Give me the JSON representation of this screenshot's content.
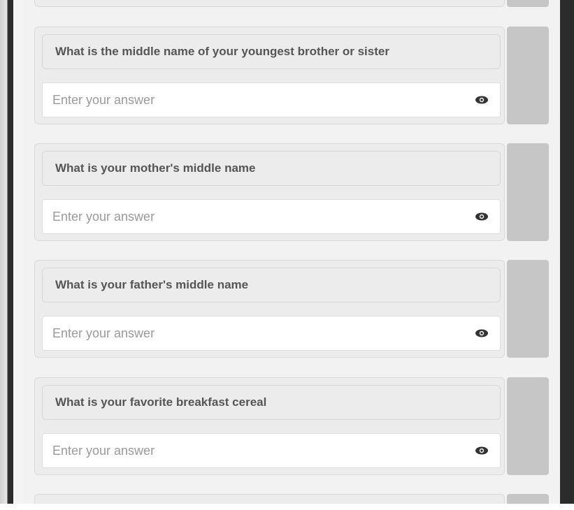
{
  "questions": [
    {
      "label": "What is the middle name of your youngest brother or sister",
      "placeholder": "Enter your answer",
      "value": ""
    },
    {
      "label": "What is your mother's middle name",
      "placeholder": "Enter your answer",
      "value": ""
    },
    {
      "label": "What is your father's middle name",
      "placeholder": "Enter your answer",
      "value": ""
    },
    {
      "label": "What is your favorite breakfast cereal",
      "placeholder": "Enter your answer",
      "value": ""
    }
  ],
  "icons": {
    "reveal": "eye-icon"
  },
  "colors": {
    "panel_background": "#f2f2f2",
    "card_background": "#ececec",
    "side_bar": "#c6c6c6",
    "frame": "#2b2b2b",
    "question_text": "#555555",
    "placeholder_text": "#9a9a9a"
  }
}
